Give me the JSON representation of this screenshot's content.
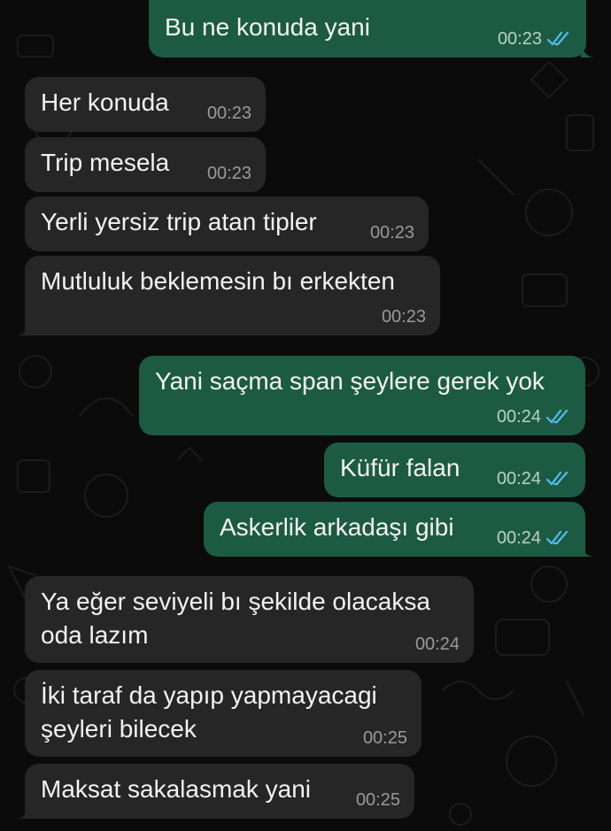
{
  "messages": [
    {
      "text": "Bu ne konuda yani",
      "time": "00:23",
      "dir": "out"
    },
    {
      "text": "Her konuda",
      "time": "00:23",
      "dir": "in"
    },
    {
      "text": "Trip mesela",
      "time": "00:23",
      "dir": "in"
    },
    {
      "text": "Yerli yersiz trip atan tipler",
      "time": "00:23",
      "dir": "in"
    },
    {
      "text": "Mutluluk beklemesin bı erkekten",
      "time": "00:23",
      "dir": "in"
    },
    {
      "text": "Yani saçma span şeylere gerek yok",
      "time": "00:24",
      "dir": "out"
    },
    {
      "text": "Küfür falan",
      "time": "00:24",
      "dir": "out"
    },
    {
      "text": "Askerlik arkadaşı gibi",
      "time": "00:24",
      "dir": "out"
    },
    {
      "text": "Ya eğer seviyeli bı şekilde olacaksa oda lazım",
      "time": "00:24",
      "dir": "in"
    },
    {
      "text": "İki taraf da yapıp yapmayacagi şeyleri bilecek",
      "time": "00:25",
      "dir": "in"
    },
    {
      "text": "Maksat sakalasmak yani",
      "time": "00:25",
      "dir": "in"
    }
  ],
  "colors": {
    "incoming_bubble": "#262626",
    "outgoing_bubble": "#1d5a44",
    "read_ticks": "#53bdeb"
  },
  "icons": {
    "read_receipt": "double-check-icon"
  }
}
